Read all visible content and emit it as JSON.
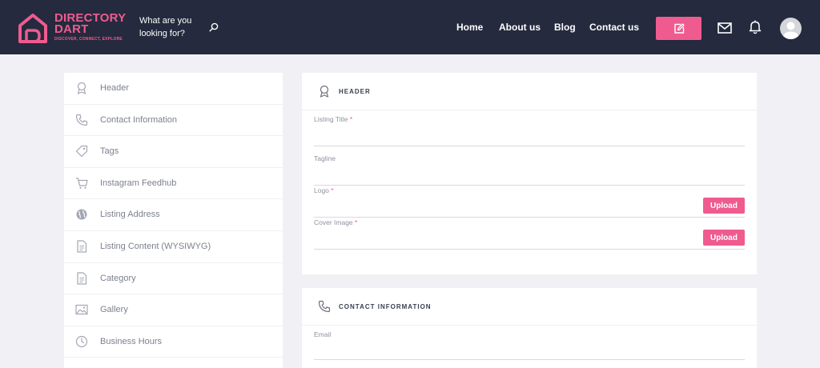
{
  "brand": {
    "title_line1": "DIRECTORY",
    "title_line2": "DART",
    "tagline": "DISCOVER, CONNECT, EXPLORE",
    "accent_color": "#ef5b8f",
    "nav_bg": "#252a3e"
  },
  "search": {
    "prompt": "What are you looking for?",
    "icon": "search-icon"
  },
  "nav": {
    "links": [
      "Home",
      "About us",
      "Blog",
      "Contact us"
    ],
    "add_listing_icon": "edit-icon",
    "mail_icon": "mail-icon",
    "notification_icon": "bell-icon",
    "avatar_icon": "user-avatar"
  },
  "sidebar": {
    "items": [
      {
        "label": "Header",
        "icon": "award-icon"
      },
      {
        "label": "Contact Information",
        "icon": "phone-icon"
      },
      {
        "label": "Tags",
        "icon": "tag-icon"
      },
      {
        "label": "Instagram Feedhub",
        "icon": "cart-icon"
      },
      {
        "label": "Listing Address",
        "icon": "globe-icon"
      },
      {
        "label": "Listing Content (WYSIWYG)",
        "icon": "document-icon"
      },
      {
        "label": "Category",
        "icon": "document-icon"
      },
      {
        "label": "Gallery",
        "icon": "image-icon"
      },
      {
        "label": "Business Hours",
        "icon": "clock-icon"
      }
    ]
  },
  "header_section": {
    "title": "HEADER",
    "icon": "award-icon",
    "fields": [
      {
        "label": "Listing Title",
        "required": "*",
        "value": ""
      },
      {
        "label": "Tagline",
        "value": ""
      },
      {
        "label": "Logo",
        "required": "*",
        "button": "Upload"
      },
      {
        "label": "Cover Image",
        "required": "*",
        "button": "Upload"
      }
    ]
  },
  "contact_section": {
    "title": "CONTACT INFORMATION",
    "icon": "phone-icon",
    "fields": [
      {
        "label": "Email",
        "value": ""
      }
    ]
  }
}
